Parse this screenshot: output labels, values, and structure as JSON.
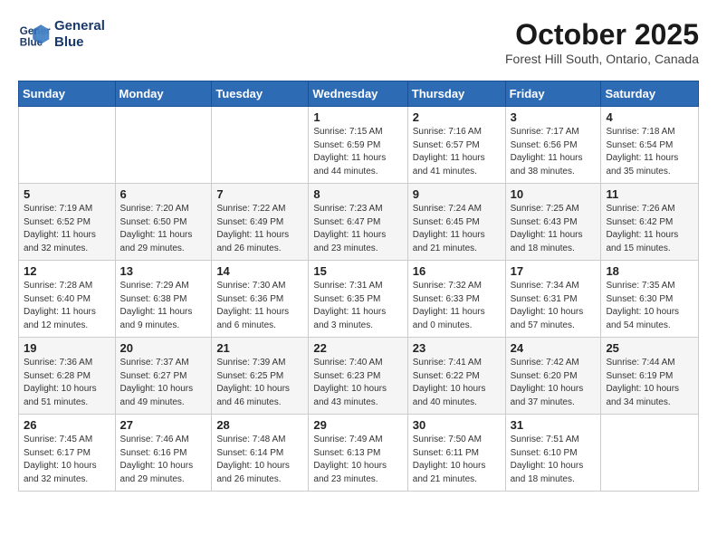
{
  "header": {
    "logo_line1": "General",
    "logo_line2": "Blue",
    "month": "October 2025",
    "location": "Forest Hill South, Ontario, Canada"
  },
  "weekdays": [
    "Sunday",
    "Monday",
    "Tuesday",
    "Wednesday",
    "Thursday",
    "Friday",
    "Saturday"
  ],
  "weeks": [
    [
      {
        "day": "",
        "info": ""
      },
      {
        "day": "",
        "info": ""
      },
      {
        "day": "",
        "info": ""
      },
      {
        "day": "1",
        "info": "Sunrise: 7:15 AM\nSunset: 6:59 PM\nDaylight: 11 hours\nand 44 minutes."
      },
      {
        "day": "2",
        "info": "Sunrise: 7:16 AM\nSunset: 6:57 PM\nDaylight: 11 hours\nand 41 minutes."
      },
      {
        "day": "3",
        "info": "Sunrise: 7:17 AM\nSunset: 6:56 PM\nDaylight: 11 hours\nand 38 minutes."
      },
      {
        "day": "4",
        "info": "Sunrise: 7:18 AM\nSunset: 6:54 PM\nDaylight: 11 hours\nand 35 minutes."
      }
    ],
    [
      {
        "day": "5",
        "info": "Sunrise: 7:19 AM\nSunset: 6:52 PM\nDaylight: 11 hours\nand 32 minutes."
      },
      {
        "day": "6",
        "info": "Sunrise: 7:20 AM\nSunset: 6:50 PM\nDaylight: 11 hours\nand 29 minutes."
      },
      {
        "day": "7",
        "info": "Sunrise: 7:22 AM\nSunset: 6:49 PM\nDaylight: 11 hours\nand 26 minutes."
      },
      {
        "day": "8",
        "info": "Sunrise: 7:23 AM\nSunset: 6:47 PM\nDaylight: 11 hours\nand 23 minutes."
      },
      {
        "day": "9",
        "info": "Sunrise: 7:24 AM\nSunset: 6:45 PM\nDaylight: 11 hours\nand 21 minutes."
      },
      {
        "day": "10",
        "info": "Sunrise: 7:25 AM\nSunset: 6:43 PM\nDaylight: 11 hours\nand 18 minutes."
      },
      {
        "day": "11",
        "info": "Sunrise: 7:26 AM\nSunset: 6:42 PM\nDaylight: 11 hours\nand 15 minutes."
      }
    ],
    [
      {
        "day": "12",
        "info": "Sunrise: 7:28 AM\nSunset: 6:40 PM\nDaylight: 11 hours\nand 12 minutes."
      },
      {
        "day": "13",
        "info": "Sunrise: 7:29 AM\nSunset: 6:38 PM\nDaylight: 11 hours\nand 9 minutes."
      },
      {
        "day": "14",
        "info": "Sunrise: 7:30 AM\nSunset: 6:36 PM\nDaylight: 11 hours\nand 6 minutes."
      },
      {
        "day": "15",
        "info": "Sunrise: 7:31 AM\nSunset: 6:35 PM\nDaylight: 11 hours\nand 3 minutes."
      },
      {
        "day": "16",
        "info": "Sunrise: 7:32 AM\nSunset: 6:33 PM\nDaylight: 11 hours\nand 0 minutes."
      },
      {
        "day": "17",
        "info": "Sunrise: 7:34 AM\nSunset: 6:31 PM\nDaylight: 10 hours\nand 57 minutes."
      },
      {
        "day": "18",
        "info": "Sunrise: 7:35 AM\nSunset: 6:30 PM\nDaylight: 10 hours\nand 54 minutes."
      }
    ],
    [
      {
        "day": "19",
        "info": "Sunrise: 7:36 AM\nSunset: 6:28 PM\nDaylight: 10 hours\nand 51 minutes."
      },
      {
        "day": "20",
        "info": "Sunrise: 7:37 AM\nSunset: 6:27 PM\nDaylight: 10 hours\nand 49 minutes."
      },
      {
        "day": "21",
        "info": "Sunrise: 7:39 AM\nSunset: 6:25 PM\nDaylight: 10 hours\nand 46 minutes."
      },
      {
        "day": "22",
        "info": "Sunrise: 7:40 AM\nSunset: 6:23 PM\nDaylight: 10 hours\nand 43 minutes."
      },
      {
        "day": "23",
        "info": "Sunrise: 7:41 AM\nSunset: 6:22 PM\nDaylight: 10 hours\nand 40 minutes."
      },
      {
        "day": "24",
        "info": "Sunrise: 7:42 AM\nSunset: 6:20 PM\nDaylight: 10 hours\nand 37 minutes."
      },
      {
        "day": "25",
        "info": "Sunrise: 7:44 AM\nSunset: 6:19 PM\nDaylight: 10 hours\nand 34 minutes."
      }
    ],
    [
      {
        "day": "26",
        "info": "Sunrise: 7:45 AM\nSunset: 6:17 PM\nDaylight: 10 hours\nand 32 minutes."
      },
      {
        "day": "27",
        "info": "Sunrise: 7:46 AM\nSunset: 6:16 PM\nDaylight: 10 hours\nand 29 minutes."
      },
      {
        "day": "28",
        "info": "Sunrise: 7:48 AM\nSunset: 6:14 PM\nDaylight: 10 hours\nand 26 minutes."
      },
      {
        "day": "29",
        "info": "Sunrise: 7:49 AM\nSunset: 6:13 PM\nDaylight: 10 hours\nand 23 minutes."
      },
      {
        "day": "30",
        "info": "Sunrise: 7:50 AM\nSunset: 6:11 PM\nDaylight: 10 hours\nand 21 minutes."
      },
      {
        "day": "31",
        "info": "Sunrise: 7:51 AM\nSunset: 6:10 PM\nDaylight: 10 hours\nand 18 minutes."
      },
      {
        "day": "",
        "info": ""
      }
    ]
  ]
}
